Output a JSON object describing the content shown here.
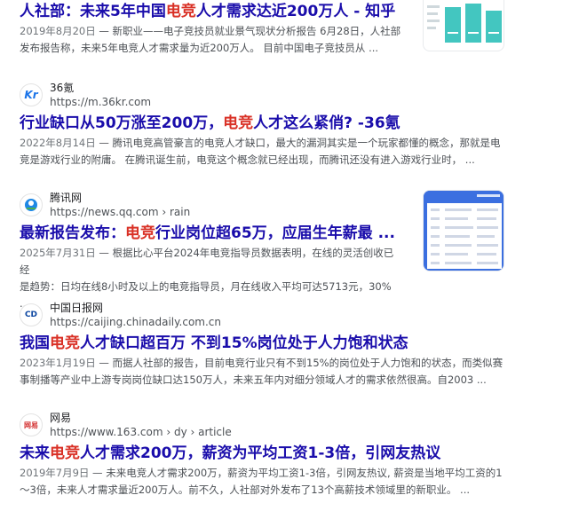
{
  "results": [
    {
      "title_pre": "人社部：未来5年中国",
      "title_hl": "电竞",
      "title_post": "人才需求达近200万人 - 知乎",
      "date": "2019年8月20日",
      "snippet_l1_rest": " — 新职业——电子竞技员就业景气现状分析报告 6月28日，人社部",
      "snippet_l2": "发布报告称，未来5年电竞人才需求量为近200万人。 目前中国电子竞技员从 ..."
    },
    {
      "site_name": "36氪",
      "site_url": "https://m.36kr.com",
      "favicon_text": "Kr",
      "title_pre": "行业缺口从50万涨至200万，",
      "title_hl": "电竞",
      "title_post": "人才这么紧俏? -36氪",
      "date": "2022年8月14日",
      "snippet_l1_rest": " — 腾讯电竞高管豪言的电竞人才缺口，最大的漏洞其实是一个玩家都懂的概念，那就是电",
      "snippet_l2": "竞是游戏行业的附庸。 在腾讯诞生前，电竞这个概念就已经出现，而腾讯还没有进入游戏行业时， ..."
    },
    {
      "site_name": "腾讯网",
      "site_url": "https://news.qq.com › rain",
      "title_pre": "最新报告发布：",
      "title_hl": "电竞",
      "title_post": "行业岗位超65万，应届生年薪最 ...",
      "date": "2025年7月31日",
      "snippet_l1_rest": " — 根据比心平台2024年电竞指导员数据表明，在线的灵活创收已经",
      "snippet_l2": "是趋势：日均在线8小时及以上的电竞指导员，月在线收入平均可达5713元，30% ..."
    },
    {
      "site_name": "中国日报网",
      "site_url": "https://caijing.chinadaily.com.cn",
      "favicon_text": "CD",
      "title_pre": "我国",
      "title_hl": "电竞",
      "title_post": "人才缺口超百万 不到15%岗位处于人力饱和状态",
      "date": "2023年1月19日",
      "snippet_l1_rest": " — 而据人社部的报告，目前电竞行业只有不到15%的岗位处于人力饱和的状态，而类似赛",
      "snippet_l2": "事制播等产业中上游专岗岗位缺口达150万人，未来五年内对细分领域人才的需求依然很高。自2003 ..."
    },
    {
      "site_name": "网易",
      "site_url": "https://www.163.com › dy › article",
      "favicon_text": "网易",
      "title_pre": "未来",
      "title_hl": "电竞",
      "title_post": "人才需求200万，薪资为平均工资1-3倍，引网友热议",
      "date": "2019年7月9日",
      "snippet_l1_rest": " — 未来电竞人才需求200万，薪资为平均工资1-3倍，引网友热议, 薪资是当地平均工资的1",
      "snippet_l2": "～3倍，未来人才需求量近200万人。前不久，人社部对外发布了13个高薪技术领域里的新职业。 ..."
    }
  ],
  "colors": {
    "title": "#1a0dab",
    "highlight": "#d93025",
    "snippet": "#4d5156",
    "thumb_teal": "#43c6c0",
    "thumb_blue": "#3b6fe0"
  }
}
